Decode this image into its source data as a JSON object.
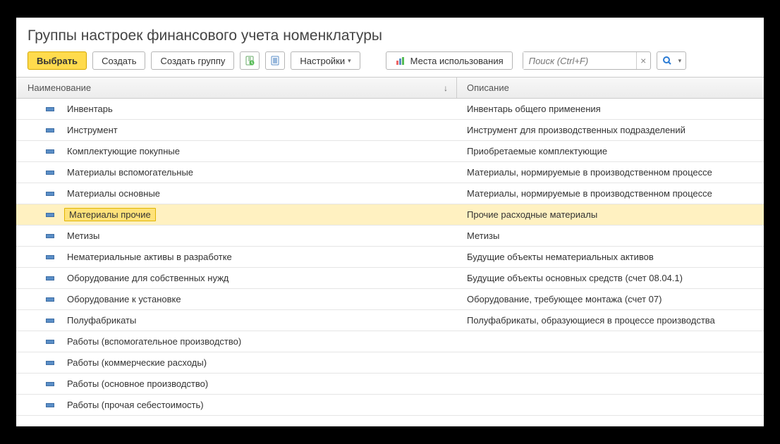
{
  "title": "Группы настроек финансового учета номенклатуры",
  "toolbar": {
    "select_label": "Выбрать",
    "create_label": "Создать",
    "create_group_label": "Создать группу",
    "settings_label": "Настройки",
    "usage_label": "Места использования"
  },
  "search": {
    "placeholder": "Поиск (Ctrl+F)"
  },
  "columns": {
    "name": "Наименование",
    "desc": "Описание"
  },
  "rows": [
    {
      "name": "Инвентарь",
      "desc": "Инвентарь общего применения",
      "selected": false
    },
    {
      "name": "Инструмент",
      "desc": "Инструмент для производственных подразделений",
      "selected": false
    },
    {
      "name": "Комплектующие покупные",
      "desc": "Приобретаемые комплектующие",
      "selected": false
    },
    {
      "name": "Материалы вспомогательные",
      "desc": "Материалы, нормируемые в производственном процессе",
      "selected": false
    },
    {
      "name": "Материалы основные",
      "desc": "Материалы, нормируемые в производственном процессе",
      "selected": false
    },
    {
      "name": "Материалы прочие",
      "desc": "Прочие расходные материалы",
      "selected": true
    },
    {
      "name": "Метизы",
      "desc": "Метизы",
      "selected": false
    },
    {
      "name": "Нематериальные активы в разработке",
      "desc": "Будущие объекты нематериальных активов",
      "selected": false
    },
    {
      "name": "Оборудование для собственных нужд",
      "desc": "Будущие объекты основных средств (счет 08.04.1)",
      "selected": false
    },
    {
      "name": "Оборудование к установке",
      "desc": "Оборудование, требующее монтажа (счет 07)",
      "selected": false
    },
    {
      "name": "Полуфабрикаты",
      "desc": "Полуфабрикаты, образующиеся в процессе производства",
      "selected": false
    },
    {
      "name": "Работы (вспомогательное производство)",
      "desc": "",
      "selected": false
    },
    {
      "name": "Работы (коммерческие расходы)",
      "desc": "",
      "selected": false
    },
    {
      "name": "Работы (основное производство)",
      "desc": "",
      "selected": false
    },
    {
      "name": "Работы (прочая себестоимость)",
      "desc": "",
      "selected": false
    }
  ]
}
